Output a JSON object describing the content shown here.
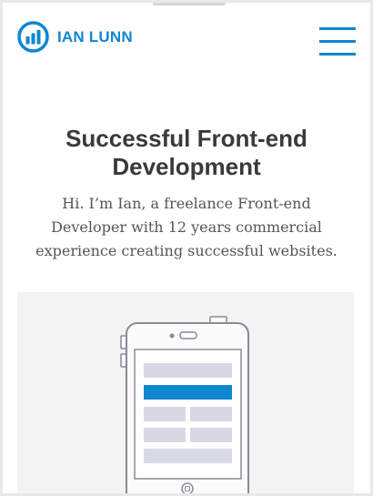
{
  "header": {
    "logo_text": "IAN LUNN",
    "logo_icon": "bar-chart-logo-icon",
    "menu_icon": "hamburger-menu-icon"
  },
  "hero": {
    "title_lines": [
      "Successful Front-end",
      "Development"
    ],
    "intro_lines": [
      "Hi. I’m Ian, a freelance Front-end",
      "Developer with 12 years commercial",
      "experience creating successful websites."
    ]
  },
  "illustration": {
    "icon": "mobile-phone-wireframe-illustration"
  },
  "colors": {
    "brand": "#0e86d0",
    "heading": "#3a3a3a",
    "body": "#555555",
    "phone_outline": "#8a8a9a",
    "wireframe_block": "#d9d9e6",
    "wireframe_highlight": "#0e86d0"
  }
}
